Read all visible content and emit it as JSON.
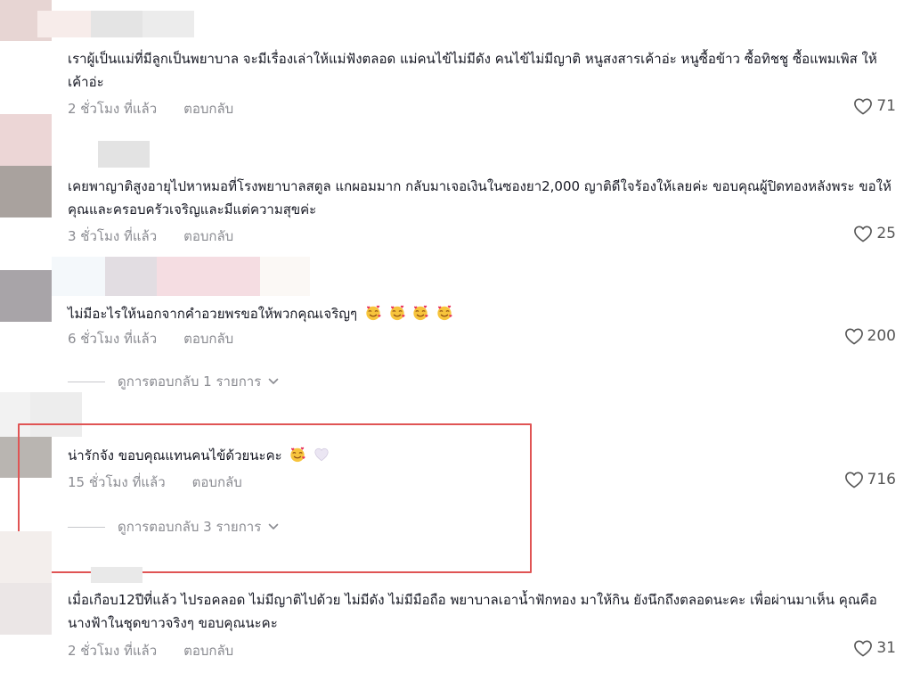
{
  "comments": [
    {
      "text": "เราผู้เป็นแม่ที่มีลูกเป็นพยาบาล จะมีเรื่องเล่าให้แม่ฟังตลอด แม่คนไข้ไม่มีดัง คนไข้ไม่มีญาติ หนูสงสารเค้าอ่ะ หนูซื้อข้าว ซื้อทิชชู ซื้อแพมเพิส ให้เค้าอ่ะ",
      "time": "2 ชั่วโมง ที่แล้ว",
      "reply": "ตอบกลับ",
      "likes": "71"
    },
    {
      "text": "เคยพาญาติสูงอายุไปหาหมอที่โรงพยาบาลสตูล แกผอมมาก กลับมาเจอเงินในซองยา2,000 ญาติดีใจร้องให้เลยค่ะ ขอบคุณผู้ปิดทองหลังพระ ขอให้คุณและครอบครัวเจริญและมีแต่ความสุขค่ะ",
      "time": "3 ชั่วโมง ที่แล้ว",
      "reply": "ตอบกลับ",
      "likes": "25"
    },
    {
      "text": "ไม่มีอะไรให้นอกจากคำอวยพรขอให้พวกคุณเจริญๆ",
      "time": "6 ชั่วโมง ที่แล้ว",
      "reply": "ตอบกลับ",
      "likes": "200",
      "view_replies": "ดูการตอบกลับ 1 รายการ"
    },
    {
      "text": "น่ารักจัง ขอบคุณแทนคนไข้ด้วยนะคะ",
      "time": "15 ชั่วโมง ที่แล้ว",
      "reply": "ตอบกลับ",
      "likes": "716",
      "view_replies": "ดูการตอบกลับ 3 รายการ"
    },
    {
      "text": "เมื่อเกือบ12ปีที่แล้ว ไปรอคลอด ไม่มีญาติไปด้วย ไม่มีดัง ไม่มีมือถือ พยาบาลเอาน้ำฟักทอง มาให้กิน ยังนึกถึงตลอดนะคะ เพื่อผ่านมาเห็น คุณคือนางฟ้าในชุดขาวจริงๆ ขอบคุณนะคะ",
      "time": "2 ชั่วโมง ที่แล้ว",
      "reply": "ตอบกลับ",
      "likes": "31"
    }
  ],
  "icons": {
    "like": "heart-outline-icon",
    "chevron": "chevron-down-icon",
    "emoji_heart_face": "smiling-face-with-hearts-icon",
    "emoji_white_heart": "white-heart-icon"
  },
  "colors": {
    "text": "#161823",
    "meta": "#8a8b91",
    "highlight": "#e05454"
  }
}
